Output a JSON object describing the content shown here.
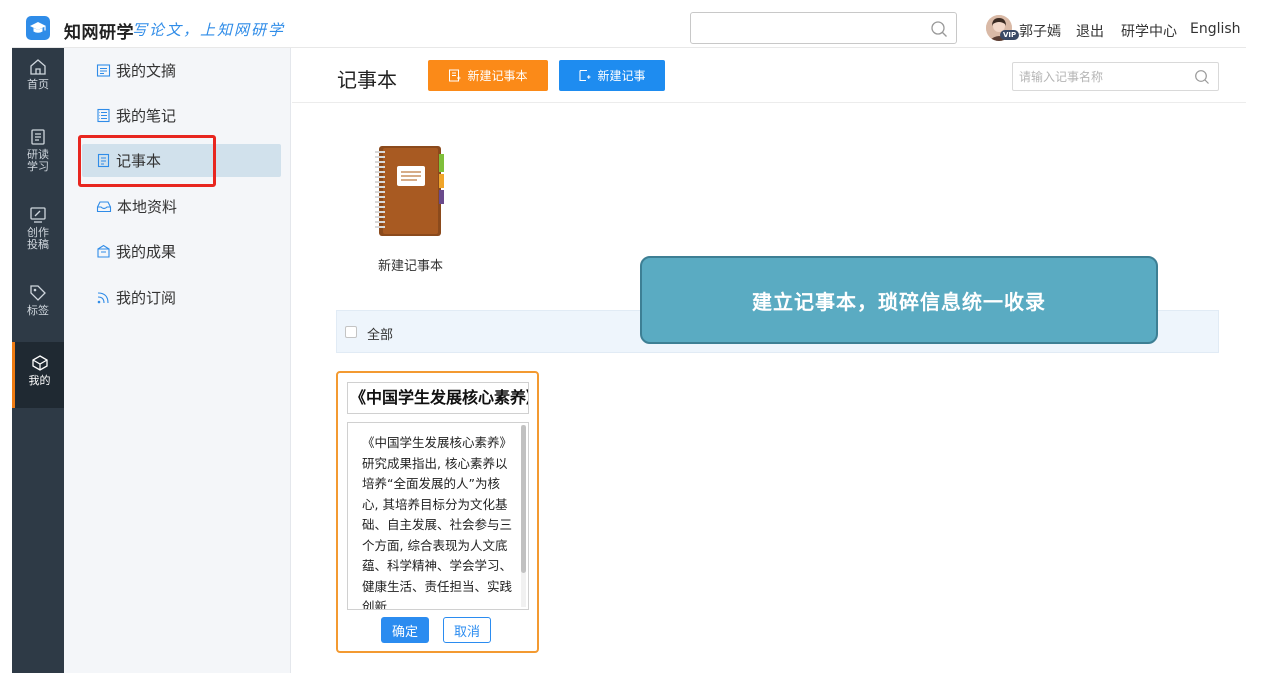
{
  "header": {
    "brand": "知网研学",
    "slogan": "写论文，上知网研学",
    "search_placeholder": "",
    "user_name": "郭子嫣",
    "vip_badge": "VIP",
    "logout": "退出",
    "research_center": "研学中心",
    "language": "English"
  },
  "nav": {
    "items": [
      {
        "label": "首页",
        "icon": "home-icon"
      },
      {
        "label": "研读\n学习",
        "icon": "document-icon"
      },
      {
        "label": "创作\n投稿",
        "icon": "monitor-pen-icon"
      },
      {
        "label": "标签",
        "icon": "tag-icon"
      },
      {
        "label": "我的",
        "icon": "cube-icon",
        "active": true
      }
    ]
  },
  "menu": {
    "items": [
      {
        "label": "我的文摘",
        "icon": "excerpt-icon"
      },
      {
        "label": "我的笔记",
        "icon": "notes-icon"
      },
      {
        "label": "记事本",
        "icon": "notebook-icon",
        "active": true
      },
      {
        "label": "本地资料",
        "icon": "inbox-icon"
      },
      {
        "label": "我的成果",
        "icon": "achievement-icon"
      },
      {
        "label": "我的订阅",
        "icon": "rss-icon"
      }
    ]
  },
  "main": {
    "title": "记事本",
    "new_notebook_button": "新建记事本",
    "new_note_button": "新建记事",
    "search_placeholder": "请输入记事名称",
    "notebook_tile_label": "新建记事本",
    "filter_all": "全部",
    "callout": "建立记事本，琐碎信息统一收录"
  },
  "card": {
    "title": "《中国学生发展核心素养》",
    "body": "《中国学生发展核心素养》研究成果指出, 核心素养以培养“全面发展的人”为核心, 其培养目标分为文化基础、自主发展、社会参与三个方面, 综合表现为人文底蕴、科学精神、学会学习、健康生活、责任担当、实践创新",
    "confirm": "确定",
    "cancel": "取消"
  },
  "colors": {
    "brand_blue": "#2f8ce8",
    "orange_button": "#fb8a18",
    "blue_button": "#1e8cf0",
    "highlight_red": "#e8261f",
    "callout_teal": "#5aabc2",
    "nav_dark": "#2e3a46",
    "active_accent": "#f07c12"
  }
}
